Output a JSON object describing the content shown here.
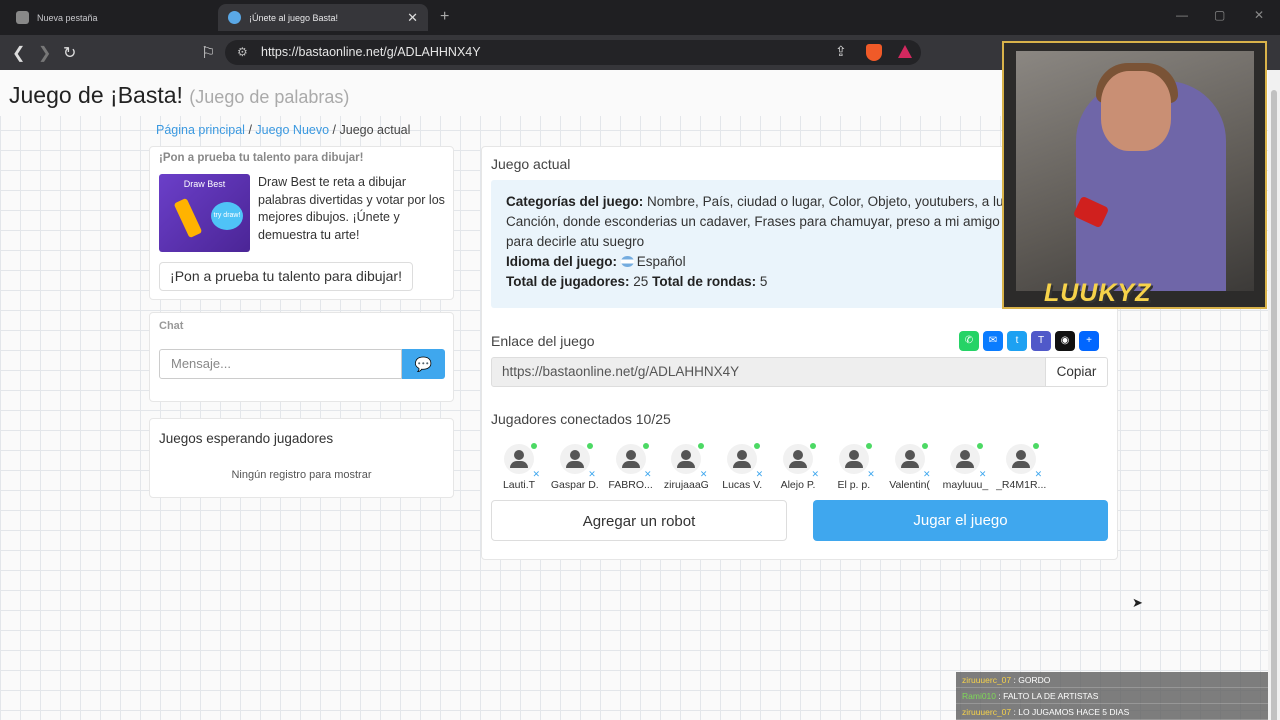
{
  "browser": {
    "tabs": [
      {
        "label": "Nueva pestaña",
        "active": false
      },
      {
        "label": "¡Únete al juego Basta!",
        "active": true
      }
    ],
    "url": "https://bastaonline.net/g/ADLAHHNX4Y"
  },
  "header": {
    "title": "Juego de ¡Basta!",
    "subtitle": "(Juego de palabras)"
  },
  "breadcrumb": {
    "home": "Página principal",
    "new_game": "Juego Nuevo",
    "current": "Juego actual"
  },
  "promo": {
    "heading": "¡Pon a prueba tu talento para dibujar!",
    "image_title": "Draw Best",
    "image_badge": "try draw!",
    "text": "Draw Best te reta a dibujar palabras divertidas y votar por los mejores dibujos. ¡Únete y demuestra tu arte!",
    "button": "¡Pon a prueba tu talento para dibujar!"
  },
  "chat": {
    "label": "Chat",
    "placeholder": "Mensaje..."
  },
  "waiting": {
    "title": "Juegos esperando jugadores",
    "empty": "Ningún registro para mostrar"
  },
  "game": {
    "section_title": "Juego actual",
    "categories_label": "Categorías del juego:",
    "categories": "Nombre, País, ciudad o lugar, Color, Objeto, youtubers, a luukyz, Animal, Canción, donde esconderias un cadaver, Frases para chamuyar, preso a mi amigo por?, frases para decirle atu suegro",
    "language_label": "Idioma del juego:",
    "language": "Español",
    "players_label": "Total de jugadores:",
    "players": "25",
    "rounds_label": "Total de rondas:",
    "rounds": "5",
    "link_label": "Enlace del juego",
    "link": "https://bastaonline.net/g/ADLAHHNX4Y",
    "copy_button": "Copiar",
    "connected_label": "Jugadores conectados 10/25",
    "add_robot": "Agregar un robot",
    "play": "Jugar el juego"
  },
  "share_icons": [
    {
      "icon": "whatsapp-icon",
      "color": "#25d366",
      "glyph": "✆"
    },
    {
      "icon": "messenger-icon",
      "color": "#0a7cff",
      "glyph": "✉"
    },
    {
      "icon": "twitter-icon",
      "color": "#1da1f2",
      "glyph": "t"
    },
    {
      "icon": "teams-icon",
      "color": "#5059c9",
      "glyph": "T"
    },
    {
      "icon": "snapchat-icon",
      "color": "#111111",
      "glyph": "◉"
    },
    {
      "icon": "share-plus-icon",
      "color": "#0166ff",
      "glyph": "+"
    }
  ],
  "players": [
    "Lauti.T",
    "Gaspar D.",
    "FABRO...",
    "zirujaaaG",
    "Lucas V.",
    "Alejo P.",
    "El p. p.",
    "Valentin(",
    "mayluuu_",
    "_R4M1R..."
  ],
  "stream": {
    "streamer": "LUUKYZ",
    "chat": [
      {
        "user": "ziruuuerc_07",
        "msg": ": GORDO"
      },
      {
        "user": "Rami010",
        "msg": ": FALTO LA DE ARTISTAS"
      },
      {
        "user": "ziruuuerc_07",
        "msg": ": LO JUGAMOS HACE 5 DIAS"
      }
    ]
  },
  "colors": {
    "accent": "#3fa7ee",
    "link": "#3b99e0",
    "info_bg": "#eaf4fb",
    "online": "#4cd964"
  }
}
